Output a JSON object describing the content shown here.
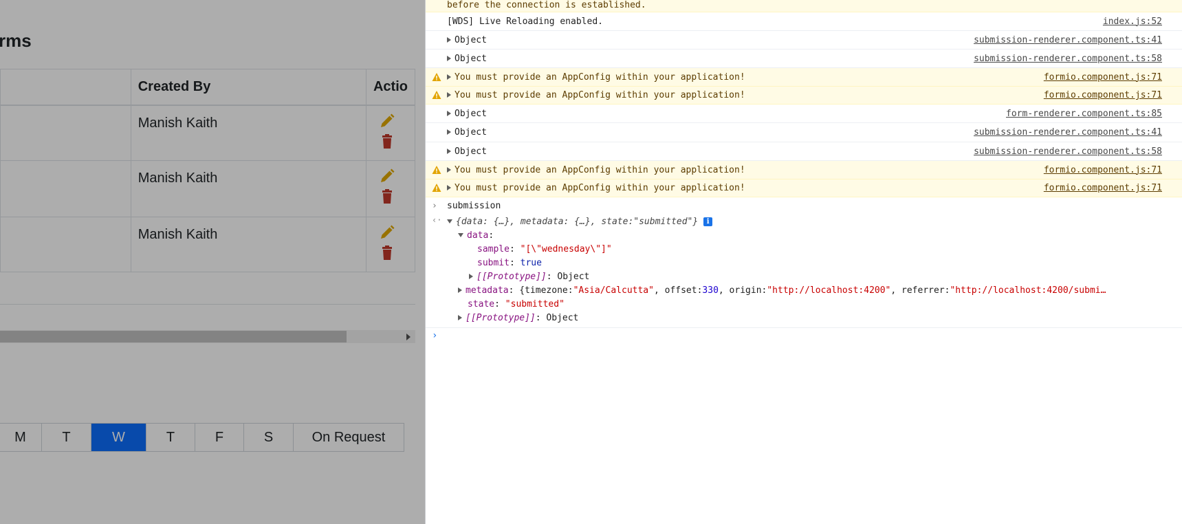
{
  "app": {
    "page_title": "rms",
    "table": {
      "headers": [
        "",
        "Created By",
        "Actio"
      ],
      "rows": [
        {
          "created_by": "Manish Kaith"
        },
        {
          "created_by": "Manish Kaith"
        },
        {
          "created_by": "Manish Kaith"
        }
      ]
    },
    "days": [
      "M",
      "T",
      "W",
      "T",
      "F",
      "S",
      "On Request"
    ],
    "active_day_index": 2,
    "colors": {
      "accent": "#0d6efd",
      "edit": "#e0a800",
      "delete": "#c0392b"
    }
  },
  "console": {
    "lines": [
      {
        "text": "before the connection is established.",
        "src": "",
        "level": "warn",
        "expandable": false
      },
      {
        "text": "[WDS] Live Reloading enabled.",
        "src": "index.js:52",
        "level": "log",
        "expandable": false
      },
      {
        "text": "Object",
        "src": "submission-renderer.component.ts:41",
        "level": "log",
        "expandable": true
      },
      {
        "text": "Object",
        "src": "submission-renderer.component.ts:58",
        "level": "log",
        "expandable": true
      },
      {
        "text": "You must provide an AppConfig within your application!",
        "src": "formio.component.js:71",
        "level": "warn",
        "expandable": true
      },
      {
        "text": "You must provide an AppConfig within your application!",
        "src": "formio.component.js:71",
        "level": "warn",
        "expandable": true
      },
      {
        "text": "Object",
        "src": "form-renderer.component.ts:85",
        "level": "log",
        "expandable": true
      },
      {
        "text": "Object",
        "src": "submission-renderer.component.ts:41",
        "level": "log",
        "expandable": true
      },
      {
        "text": "Object",
        "src": "submission-renderer.component.ts:58",
        "level": "log",
        "expandable": true
      },
      {
        "text": "You must provide an AppConfig within your application!",
        "src": "formio.component.js:71",
        "level": "warn",
        "expandable": true
      },
      {
        "text": "You must provide an AppConfig within your application!",
        "src": "formio.component.js:71",
        "level": "warn",
        "expandable": true
      }
    ],
    "command": "submission",
    "result": {
      "summary_open": "{data: {…}, metadata: {…}, state: ",
      "summary_state": "\"submitted\"",
      "summary_close": "}",
      "data_key": "data",
      "sample_key": "sample",
      "sample_value": "\"[\\\"wednesday\\\"]\"",
      "submit_key": "submit",
      "submit_value": "true",
      "proto_key": "[[Prototype]]",
      "proto_value": "Object",
      "metadata_key": "metadata",
      "metadata_preview_1": "{timezone: ",
      "metadata_tz": "\"Asia/Calcutta\"",
      "metadata_preview_2": ", offset: ",
      "metadata_offset": "330",
      "metadata_preview_3": ", origin: ",
      "metadata_origin": "\"http://localhost:4200\"",
      "metadata_preview_4": ", referrer: ",
      "metadata_referrer": "\"http://localhost:4200/submi…",
      "state_key": "state",
      "state_value": "\"submitted\""
    }
  }
}
